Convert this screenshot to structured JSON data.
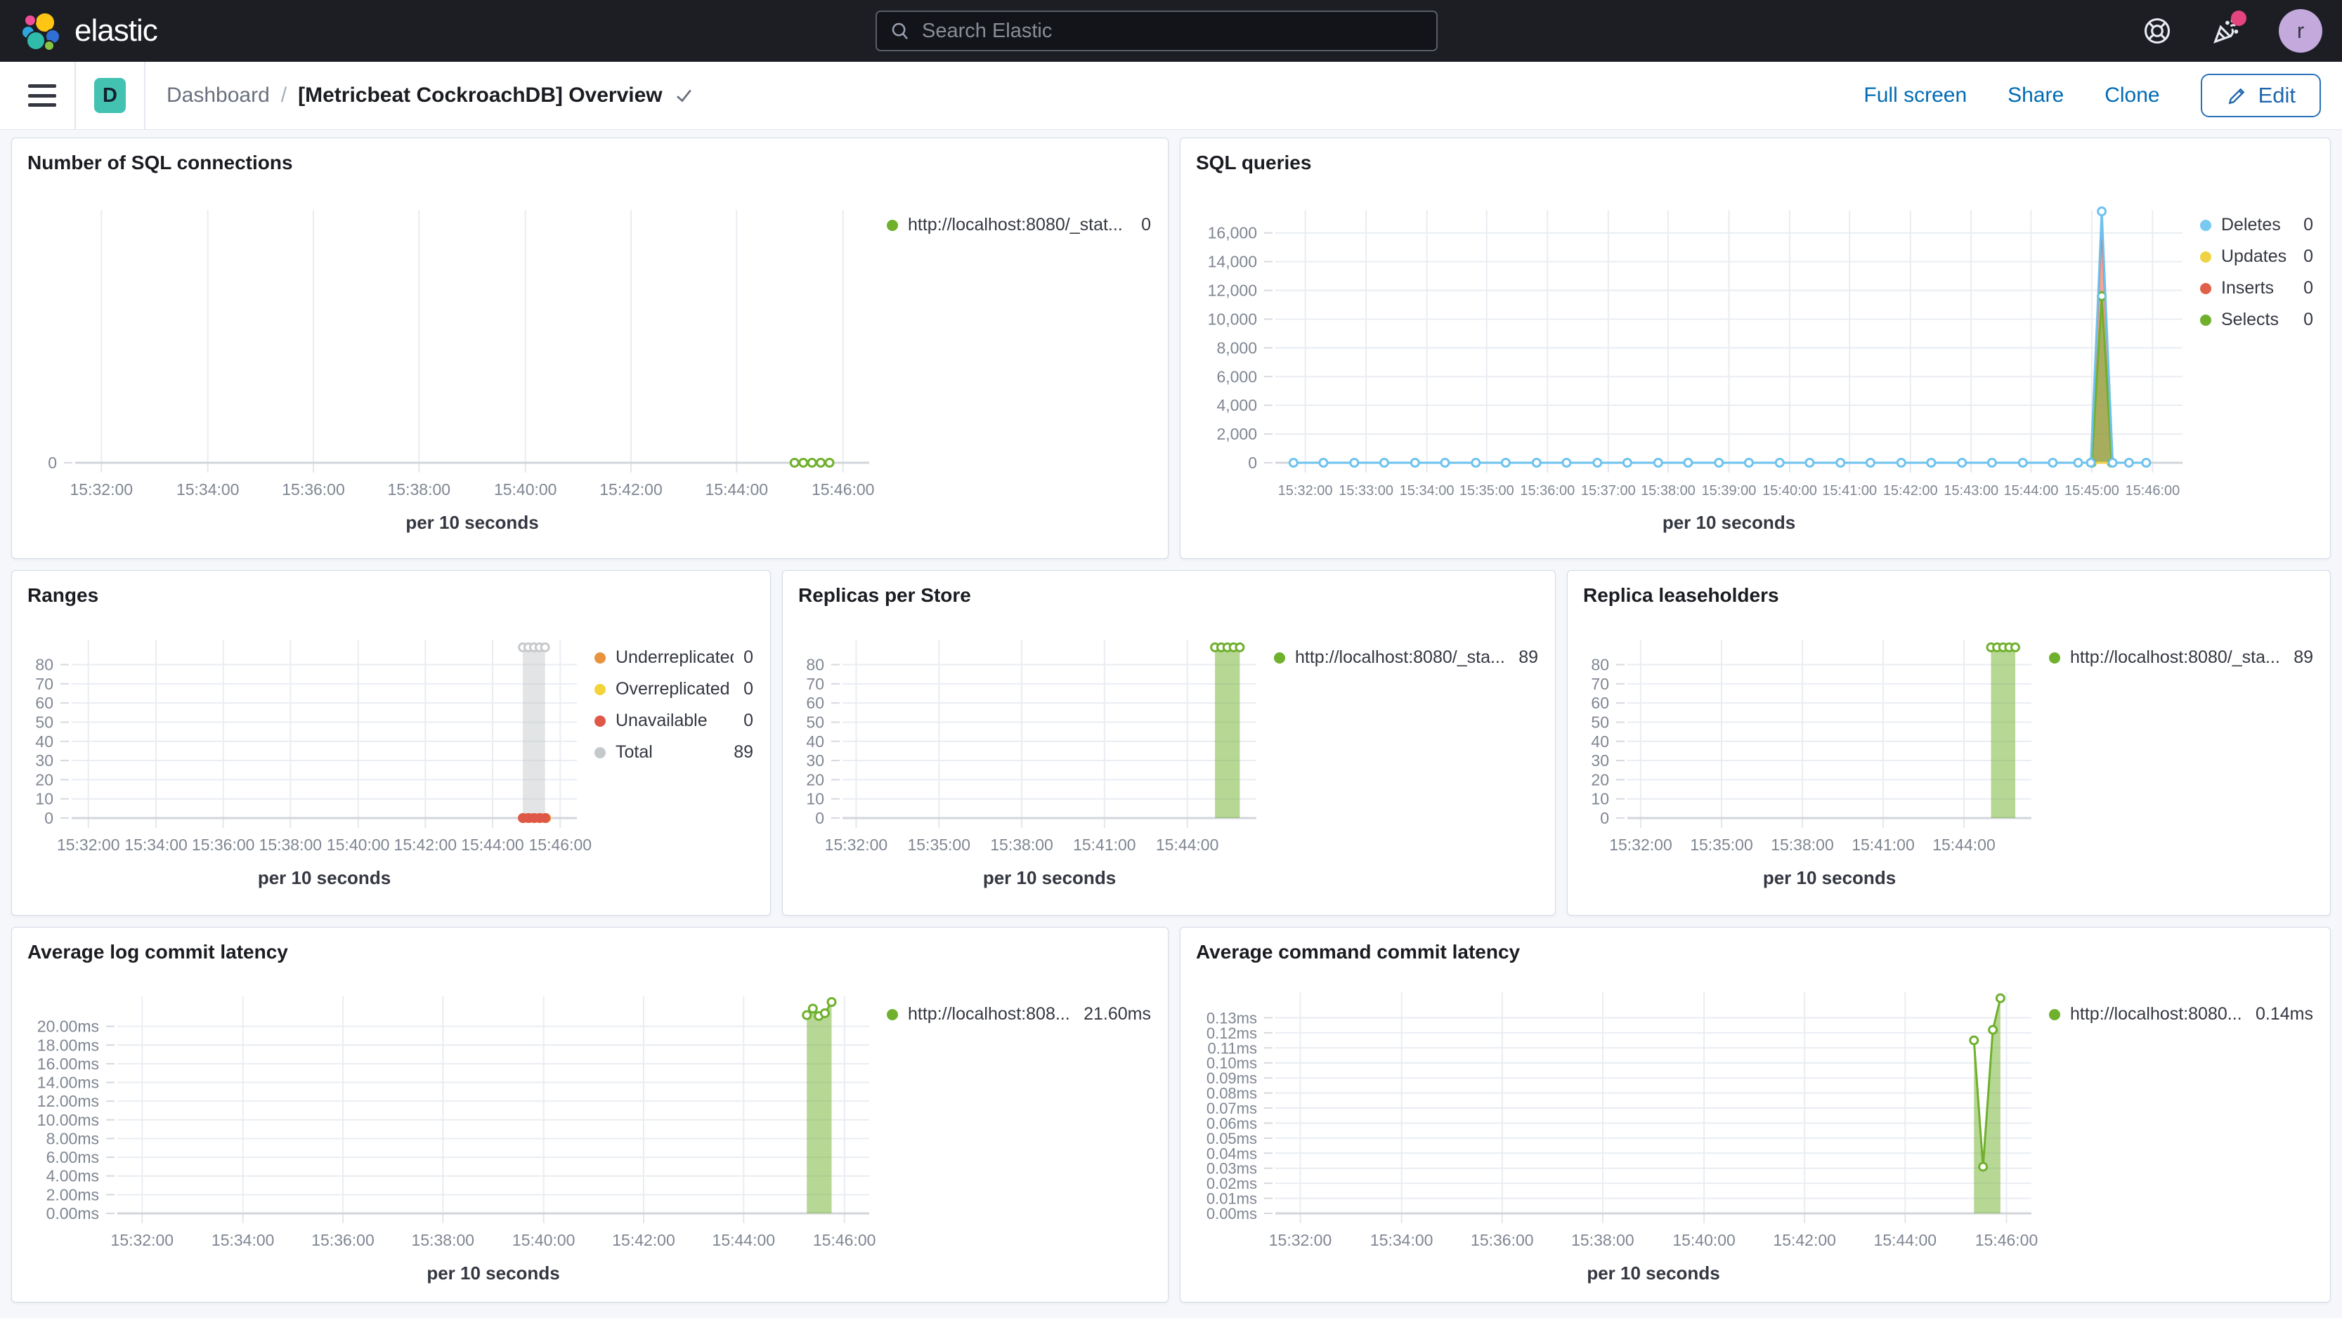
{
  "top_nav": {
    "brand": "elastic",
    "search_placeholder": "Search Elastic",
    "avatar_initial": "r"
  },
  "toolbar": {
    "breadcrumb_root": "Dashboard",
    "breadcrumb_sep": "/",
    "title": "[Metricbeat CockroachDB] Overview",
    "dash_badge": "D",
    "actions": {
      "full_screen": "Full screen",
      "share": "Share",
      "clone": "Clone",
      "edit": "Edit"
    }
  },
  "panels": [
    {
      "id": "number-of-sql-connections",
      "title": "Number of SQL connections",
      "legend": [
        {
          "label": "http://localhost:8080/_stat...",
          "value": "0",
          "color": "#6fb02c"
        }
      ]
    },
    {
      "id": "sql-queries",
      "title": "SQL queries",
      "legend": [
        {
          "label": "Deletes",
          "value": "0",
          "color": "#79c9f1"
        },
        {
          "label": "Updates",
          "value": "0",
          "color": "#f0d343"
        },
        {
          "label": "Inserts",
          "value": "0",
          "color": "#e0604a"
        },
        {
          "label": "Selects",
          "value": "0",
          "color": "#6fb02c"
        }
      ]
    },
    {
      "id": "ranges",
      "title": "Ranges",
      "legend": [
        {
          "label": "Underreplicated",
          "value": "0",
          "color": "#e8933c"
        },
        {
          "label": "Overreplicated",
          "value": "0",
          "color": "#f2d338"
        },
        {
          "label": "Unavailable",
          "value": "0",
          "color": "#df5747"
        },
        {
          "label": "Total",
          "value": "89",
          "color": "#c6c9cc"
        }
      ]
    },
    {
      "id": "replicas-per-store",
      "title": "Replicas per Store",
      "legend": [
        {
          "label": "http://localhost:8080/_sta...",
          "value": "89",
          "color": "#6fb02c"
        }
      ]
    },
    {
      "id": "replica-leaseholders",
      "title": "Replica leaseholders",
      "legend": [
        {
          "label": "http://localhost:8080/_sta...",
          "value": "89",
          "color": "#6fb02c"
        }
      ]
    },
    {
      "id": "average-log-commit-latency",
      "title": "Average log commit latency",
      "legend": [
        {
          "label": "http://localhost:808...",
          "value": "21.60ms",
          "color": "#6fb02c"
        }
      ]
    },
    {
      "id": "average-command-commit-latency",
      "title": "Average command commit latency",
      "legend": [
        {
          "label": "http://localhost:8080...",
          "value": "0.14ms",
          "color": "#6fb02c"
        }
      ]
    }
  ],
  "chart_data": [
    {
      "type": "line",
      "title": "Number of SQL connections",
      "x_axis_title": "per 10 seconds",
      "ylim": [
        0,
        10
      ],
      "y_ticks": {
        "values": [
          0
        ],
        "labels": [
          "0"
        ]
      },
      "x_ticks": {
        "pos": [
          0.033,
          0.167,
          0.3,
          0.433,
          0.567,
          0.7,
          0.833,
          0.967
        ],
        "labels": [
          "15:32:00",
          "15:34:00",
          "15:36:00",
          "15:38:00",
          "15:40:00",
          "15:42:00",
          "15:44:00",
          "15:46:00"
        ]
      },
      "margins": {
        "t": 40,
        "r": 25,
        "b": 136,
        "l": 90
      },
      "series": [
        {
          "name": "http://localhost:8080/_stat...",
          "type": "line",
          "color": "#6fb02c",
          "markers": "hollow",
          "points": [
            [
              0.906,
              0
            ],
            [
              0.917,
              0
            ],
            [
              0.928,
              0
            ],
            [
              0.939,
              0
            ],
            [
              0.95,
              0
            ]
          ]
        }
      ]
    },
    {
      "type": "line",
      "title": "SQL queries",
      "x_axis_title": "per 10 seconds",
      "ylim": [
        0,
        17600
      ],
      "x_font": 20,
      "y_ticks": {
        "values": [
          0,
          2000,
          4000,
          6000,
          8000,
          10000,
          12000,
          14000,
          16000
        ],
        "labels": [
          "0",
          "2,000",
          "4,000",
          "6,000",
          "8,000",
          "10,000",
          "12,000",
          "14,000",
          "16,000"
        ]
      },
      "x_ticks": {
        "pos": [
          0.033,
          0.1,
          0.167,
          0.233,
          0.3,
          0.367,
          0.433,
          0.5,
          0.567,
          0.633,
          0.7,
          0.767,
          0.833,
          0.9,
          0.967
        ],
        "labels": [
          "15:32:00",
          "15:33:00",
          "15:34:00",
          "15:35:00",
          "15:36:00",
          "15:37:00",
          "15:38:00",
          "15:39:00",
          "15:40:00",
          "15:41:00",
          "15:42:00",
          "15:43:00",
          "15:44:00",
          "15:45:00",
          "15:46:00"
        ]
      },
      "margins": {
        "t": 40,
        "r": 25,
        "b": 136,
        "l": 135
      },
      "series": [
        {
          "name": "Inserts",
          "type": "area",
          "color": "#e0604a",
          "fill_opacity": 0.55,
          "markers": "none",
          "points": [
            [
              0.899,
              0
            ],
            [
              0.911,
              16800
            ],
            [
              0.923,
              0
            ]
          ]
        },
        {
          "name": "Selects",
          "type": "area",
          "color": "#6fb02c",
          "fill_opacity": 0.55,
          "markers": "hollow",
          "points": [
            [
              0.9,
              0
            ],
            [
              0.911,
              11600
            ],
            [
              0.922,
              0
            ]
          ]
        },
        {
          "name": "Updates",
          "type": "line",
          "color": "#f0d343",
          "markers": "none",
          "points": [
            [
              0.02,
              0
            ],
            [
              0.96,
              0
            ]
          ]
        },
        {
          "name": "Deletes",
          "type": "line",
          "color": "#6ec2ef",
          "markers": "hollow",
          "points": [
            [
              0.02,
              0
            ],
            [
              0.053,
              0
            ],
            [
              0.087,
              0
            ],
            [
              0.12,
              0
            ],
            [
              0.154,
              0
            ],
            [
              0.187,
              0
            ],
            [
              0.221,
              0
            ],
            [
              0.254,
              0
            ],
            [
              0.288,
              0
            ],
            [
              0.321,
              0
            ],
            [
              0.355,
              0
            ],
            [
              0.388,
              0
            ],
            [
              0.422,
              0
            ],
            [
              0.455,
              0
            ],
            [
              0.489,
              0
            ],
            [
              0.522,
              0
            ],
            [
              0.556,
              0
            ],
            [
              0.589,
              0
            ],
            [
              0.623,
              0
            ],
            [
              0.656,
              0
            ],
            [
              0.69,
              0
            ],
            [
              0.723,
              0
            ],
            [
              0.757,
              0
            ],
            [
              0.79,
              0
            ],
            [
              0.824,
              0
            ],
            [
              0.857,
              0
            ],
            [
              0.885,
              0
            ],
            [
              0.899,
              0
            ],
            [
              0.911,
              17500
            ],
            [
              0.923,
              0
            ],
            [
              0.941,
              0
            ],
            [
              0.96,
              0
            ]
          ]
        }
      ]
    },
    {
      "type": "area",
      "title": "Ranges",
      "x_axis_title": "per 10 seconds",
      "ylim": [
        0,
        93
      ],
      "y_ticks": {
        "values": [
          0,
          10,
          20,
          30,
          40,
          50,
          60,
          70,
          80
        ],
        "labels": [
          "0",
          "10",
          "20",
          "30",
          "40",
          "50",
          "60",
          "70",
          "80"
        ]
      },
      "x_ticks": {
        "pos": [
          0.033,
          0.167,
          0.3,
          0.433,
          0.567,
          0.7,
          0.833,
          0.967
        ],
        "labels": [
          "15:32:00",
          "15:34:00",
          "15:36:00",
          "15:38:00",
          "15:40:00",
          "15:42:00",
          "15:44:00",
          "15:46:00"
        ]
      },
      "margins": {
        "t": 36,
        "r": 25,
        "b": 138,
        "l": 85
      },
      "series": [
        {
          "name": "Total",
          "type": "area",
          "color": "#c6c9cc",
          "fill_opacity": 0.5,
          "markers": "hollow",
          "points": [
            [
              0.893,
              89
            ],
            [
              0.904,
              89
            ],
            [
              0.915,
              89
            ],
            [
              0.926,
              89
            ],
            [
              0.937,
              89
            ]
          ]
        },
        {
          "name": "Overreplicated",
          "type": "line",
          "color": "#f2d338",
          "markers": "solid",
          "points": [
            [
              0.893,
              0
            ],
            [
              0.904,
              0
            ],
            [
              0.915,
              0
            ],
            [
              0.926,
              0
            ],
            [
              0.937,
              0
            ]
          ]
        },
        {
          "name": "Underreplicated",
          "type": "line",
          "color": "#e8933c",
          "markers": "solid",
          "points": [
            [
              0.895,
              0
            ],
            [
              0.906,
              0
            ],
            [
              0.917,
              0
            ],
            [
              0.928,
              0
            ],
            [
              0.939,
              0
            ]
          ]
        },
        {
          "name": "Unavailable",
          "type": "line",
          "color": "#df5747",
          "markers": "solid",
          "points": [
            [
              0.893,
              0
            ],
            [
              0.904,
              0
            ],
            [
              0.915,
              0
            ],
            [
              0.926,
              0
            ],
            [
              0.937,
              0
            ]
          ]
        }
      ]
    },
    {
      "type": "area",
      "title": "Replicas per Store",
      "x_axis_title": "per 10 seconds",
      "ylim": [
        0,
        93
      ],
      "y_ticks": {
        "values": [
          0,
          10,
          20,
          30,
          40,
          50,
          60,
          70,
          80
        ],
        "labels": [
          "0",
          "10",
          "20",
          "30",
          "40",
          "50",
          "60",
          "70",
          "80"
        ]
      },
      "x_ticks": {
        "pos": [
          0.033,
          0.233,
          0.433,
          0.633,
          0.833
        ],
        "labels": [
          "15:32:00",
          "15:35:00",
          "15:38:00",
          "15:41:00",
          "15:44:00"
        ]
      },
      "margins": {
        "t": 36,
        "r": 25,
        "b": 138,
        "l": 85
      },
      "series": [
        {
          "name": "http://localhost:8080/_sta...",
          "type": "area",
          "color": "#6fb02c",
          "fill_opacity": 0.5,
          "markers": "hollow",
          "points": [
            [
              0.9,
              89
            ],
            [
              0.915,
              89
            ],
            [
              0.93,
              89
            ],
            [
              0.945,
              89
            ],
            [
              0.96,
              89
            ]
          ]
        }
      ]
    },
    {
      "type": "area",
      "title": "Replica leaseholders",
      "x_axis_title": "per 10 seconds",
      "ylim": [
        0,
        93
      ],
      "y_ticks": {
        "values": [
          0,
          10,
          20,
          30,
          40,
          50,
          60,
          70,
          80
        ],
        "labels": [
          "0",
          "10",
          "20",
          "30",
          "40",
          "50",
          "60",
          "70",
          "80"
        ]
      },
      "x_ticks": {
        "pos": [
          0.033,
          0.233,
          0.433,
          0.633,
          0.833
        ],
        "labels": [
          "15:32:00",
          "15:35:00",
          "15:38:00",
          "15:41:00",
          "15:44:00"
        ]
      },
      "margins": {
        "t": 36,
        "r": 25,
        "b": 138,
        "l": 85
      },
      "series": [
        {
          "name": "http://localhost:8080/_sta...",
          "type": "area",
          "color": "#6fb02c",
          "fill_opacity": 0.5,
          "markers": "hollow",
          "points": [
            [
              0.9,
              89
            ],
            [
              0.915,
              89
            ],
            [
              0.93,
              89
            ],
            [
              0.945,
              89
            ],
            [
              0.96,
              89
            ]
          ]
        }
      ]
    },
    {
      "type": "area",
      "title": "Average log commit latency",
      "x_axis_title": "per 10 seconds",
      "ylim": [
        0,
        23.2
      ],
      "y_ticks": {
        "values": [
          0,
          2,
          4,
          6,
          8,
          10,
          12,
          14,
          16,
          18,
          20
        ],
        "labels": [
          "0.00ms",
          "2.00ms",
          "4.00ms",
          "6.00ms",
          "8.00ms",
          "10.00ms",
          "12.00ms",
          "14.00ms",
          "16.00ms",
          "18.00ms",
          "20.00ms"
        ]
      },
      "x_ticks": {
        "pos": [
          0.033,
          0.167,
          0.3,
          0.433,
          0.567,
          0.7,
          0.833,
          0.967
        ],
        "labels": [
          "15:32:00",
          "15:34:00",
          "15:36:00",
          "15:38:00",
          "15:40:00",
          "15:42:00",
          "15:44:00",
          "15:46:00"
        ]
      },
      "margins": {
        "t": 36,
        "r": 25,
        "b": 126,
        "l": 150
      },
      "series": [
        {
          "name": "http://localhost:808...",
          "type": "area",
          "color": "#6fb02c",
          "fill_opacity": 0.5,
          "markers": "hollow",
          "points": [
            [
              0.917,
              21.2
            ],
            [
              0.925,
              21.9
            ],
            [
              0.933,
              21.1
            ],
            [
              0.941,
              21.4
            ],
            [
              0.95,
              22.6
            ]
          ]
        }
      ]
    },
    {
      "type": "area",
      "title": "Average command commit latency",
      "x_axis_title": "per 10 seconds",
      "ylim": [
        0,
        0.147
      ],
      "y_font": 22,
      "y_ticks": {
        "values": [
          0,
          0.01,
          0.02,
          0.03,
          0.04,
          0.05,
          0.06,
          0.07,
          0.08,
          0.09,
          0.1,
          0.11,
          0.12,
          0.13
        ],
        "labels": [
          "0.00ms",
          "0.01ms",
          "0.02ms",
          "0.03ms",
          "0.04ms",
          "0.05ms",
          "0.06ms",
          "0.07ms",
          "0.08ms",
          "0.09ms",
          "0.10ms",
          "0.11ms",
          "0.12ms",
          "0.13ms"
        ]
      },
      "x_ticks": {
        "pos": [
          0.033,
          0.167,
          0.3,
          0.433,
          0.567,
          0.7,
          0.833,
          0.967
        ],
        "labels": [
          "15:32:00",
          "15:34:00",
          "15:36:00",
          "15:38:00",
          "15:40:00",
          "15:42:00",
          "15:44:00",
          "15:46:00"
        ]
      },
      "margins": {
        "t": 30,
        "r": 25,
        "b": 126,
        "l": 135
      },
      "series": [
        {
          "name": "http://localhost:8080...",
          "type": "area",
          "color": "#6fb02c",
          "fill_opacity": 0.5,
          "markers": "hollow",
          "points": [
            [
              0.924,
              0.115
            ],
            [
              0.936,
              0.031
            ],
            [
              0.949,
              0.122
            ],
            [
              0.959,
              0.143
            ]
          ]
        }
      ]
    }
  ]
}
